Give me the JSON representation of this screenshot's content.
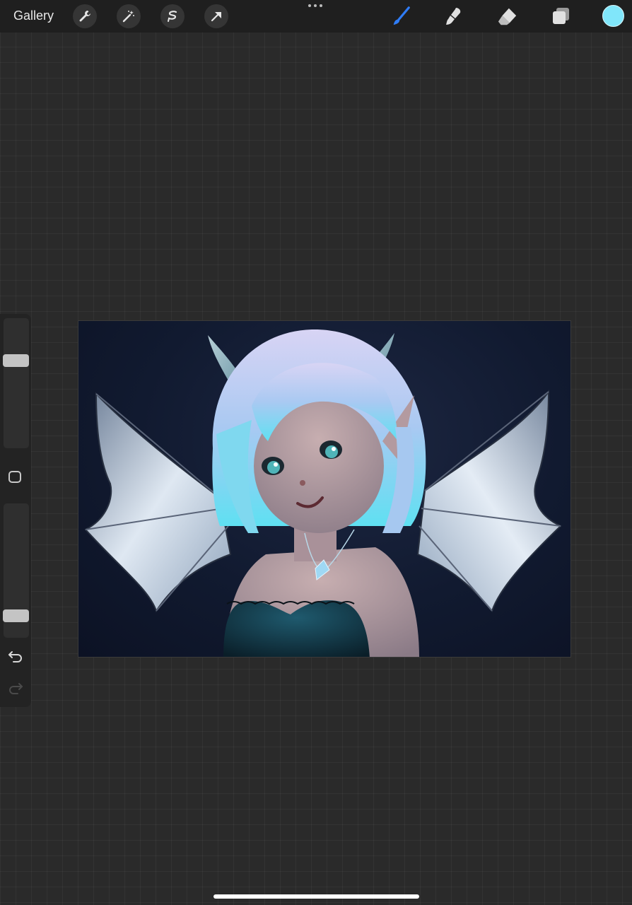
{
  "topbar": {
    "gallery_label": "Gallery",
    "left_tools": [
      "wrench-icon",
      "magic-wand-icon",
      "selection-icon",
      "transform-arrow-icon"
    ],
    "more_menu": "ellipsis-icon",
    "right_tools": [
      "brush-icon",
      "smudge-icon",
      "eraser-icon",
      "layers-icon"
    ],
    "active_tool": "brush-icon",
    "active_color": "#80e6fa",
    "accent": "#2f7cf6"
  },
  "sidebar": {
    "size_level": 0.69,
    "opacity_level": 0.13,
    "buttons": [
      "modify-square-icon",
      "undo-icon",
      "redo-icon"
    ]
  },
  "canvas": {
    "background": "#111a30"
  }
}
